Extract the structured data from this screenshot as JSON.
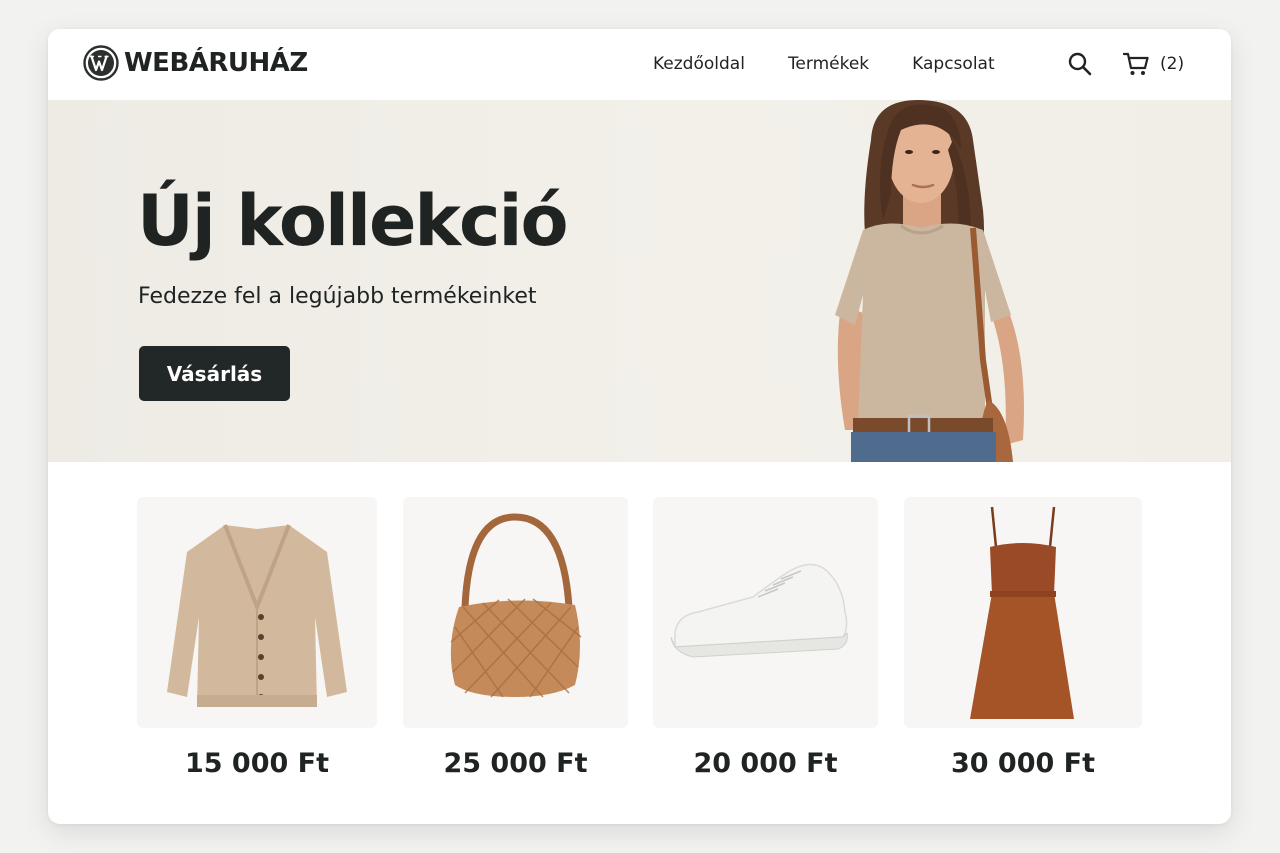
{
  "header": {
    "brand": "WEBÁRUHÁZ",
    "logo_icon": "wordpress-logo-icon",
    "nav": [
      {
        "label": "Kezdőoldal"
      },
      {
        "label": "Termékek"
      },
      {
        "label": "Kapcsolat"
      }
    ],
    "search_icon": "search-icon",
    "cart_icon": "cart-icon",
    "cart_count": "(2)"
  },
  "hero": {
    "title": "Új kollekció",
    "subtitle": "Fedezze fel a legújabb termékeinket",
    "cta_label": "Vásárlás"
  },
  "products": [
    {
      "image": "beige-cardigan",
      "price": "15 000 Ft"
    },
    {
      "image": "brown-woven-handbag",
      "price": "25 000 Ft"
    },
    {
      "image": "white-sneaker",
      "price": "20 000 Ft"
    },
    {
      "image": "rust-slip-dress",
      "price": "30 000 Ft"
    }
  ],
  "colors": {
    "text": "#1f2322",
    "button_bg": "#212827",
    "hero_bg": "#f1eee8",
    "page_bg": "#f2f2f1"
  }
}
